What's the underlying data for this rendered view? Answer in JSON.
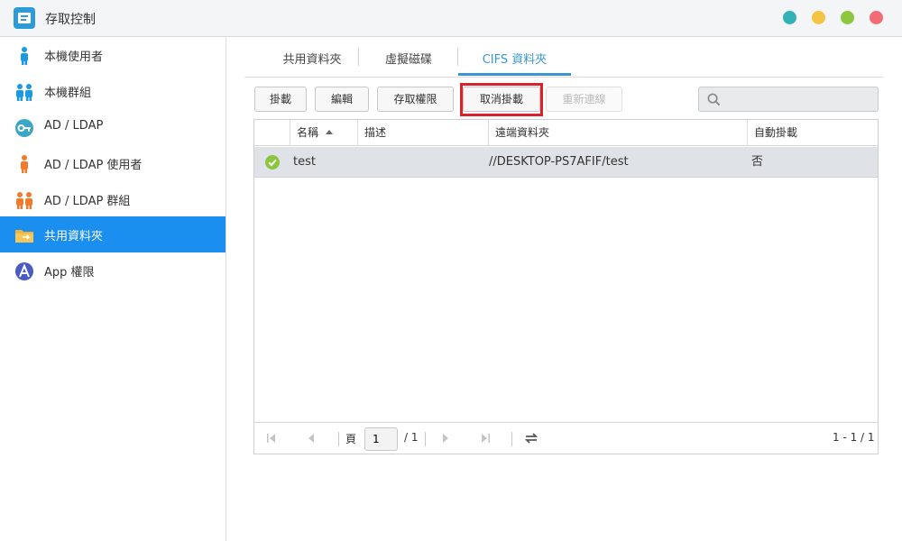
{
  "window": {
    "title": "存取控制",
    "controls": [
      {
        "name": "help",
        "color": "#33b1b6"
      },
      {
        "name": "minimize",
        "color": "#f6c443"
      },
      {
        "name": "maximize",
        "color": "#8cc73f"
      },
      {
        "name": "close",
        "color": "#f26c78"
      }
    ]
  },
  "sidebar": {
    "items": [
      {
        "label": "本機使用者",
        "icon": "user-icon"
      },
      {
        "label": "本機群組",
        "icon": "group-icon"
      },
      {
        "label": "AD / LDAP",
        "icon": "key-icon"
      },
      {
        "label": "AD / LDAP 使用者",
        "icon": "ad-user-icon"
      },
      {
        "label": "AD / LDAP 群組",
        "icon": "ad-group-icon"
      },
      {
        "label": "共用資料夾",
        "icon": "shared-folder-icon",
        "active": true
      },
      {
        "label": "App 權限",
        "icon": "app-permission-icon"
      }
    ]
  },
  "tabs": [
    {
      "label": "共用資料夾"
    },
    {
      "label": "虛擬磁碟"
    },
    {
      "label": "CIFS 資料夾",
      "active": true
    }
  ],
  "toolbar": {
    "mount": "掛載",
    "edit": "編輯",
    "access": "存取權限",
    "unmount": "取消掛載",
    "reconnect": "重新連線",
    "search_placeholder": ""
  },
  "grid": {
    "columns": {
      "name": "名稱",
      "description": "描述",
      "remote": "遠端資料夾",
      "automount": "自動掛載"
    },
    "rows": [
      {
        "status": "connected",
        "name": "test",
        "description": "",
        "remote": "//DESKTOP-PS7AFIF/test",
        "automount": "否"
      }
    ]
  },
  "pager": {
    "page_label": "頁",
    "page_value": "1",
    "total_pages": "/ 1",
    "summary": "1 - 1 / 1"
  },
  "colors": {
    "accent": "#1a8ff0",
    "tab_accent": "#3a95d0",
    "highlight": "#d9232a",
    "row_selected": "#dfe3e8",
    "status_ok": "#8cc63f"
  }
}
